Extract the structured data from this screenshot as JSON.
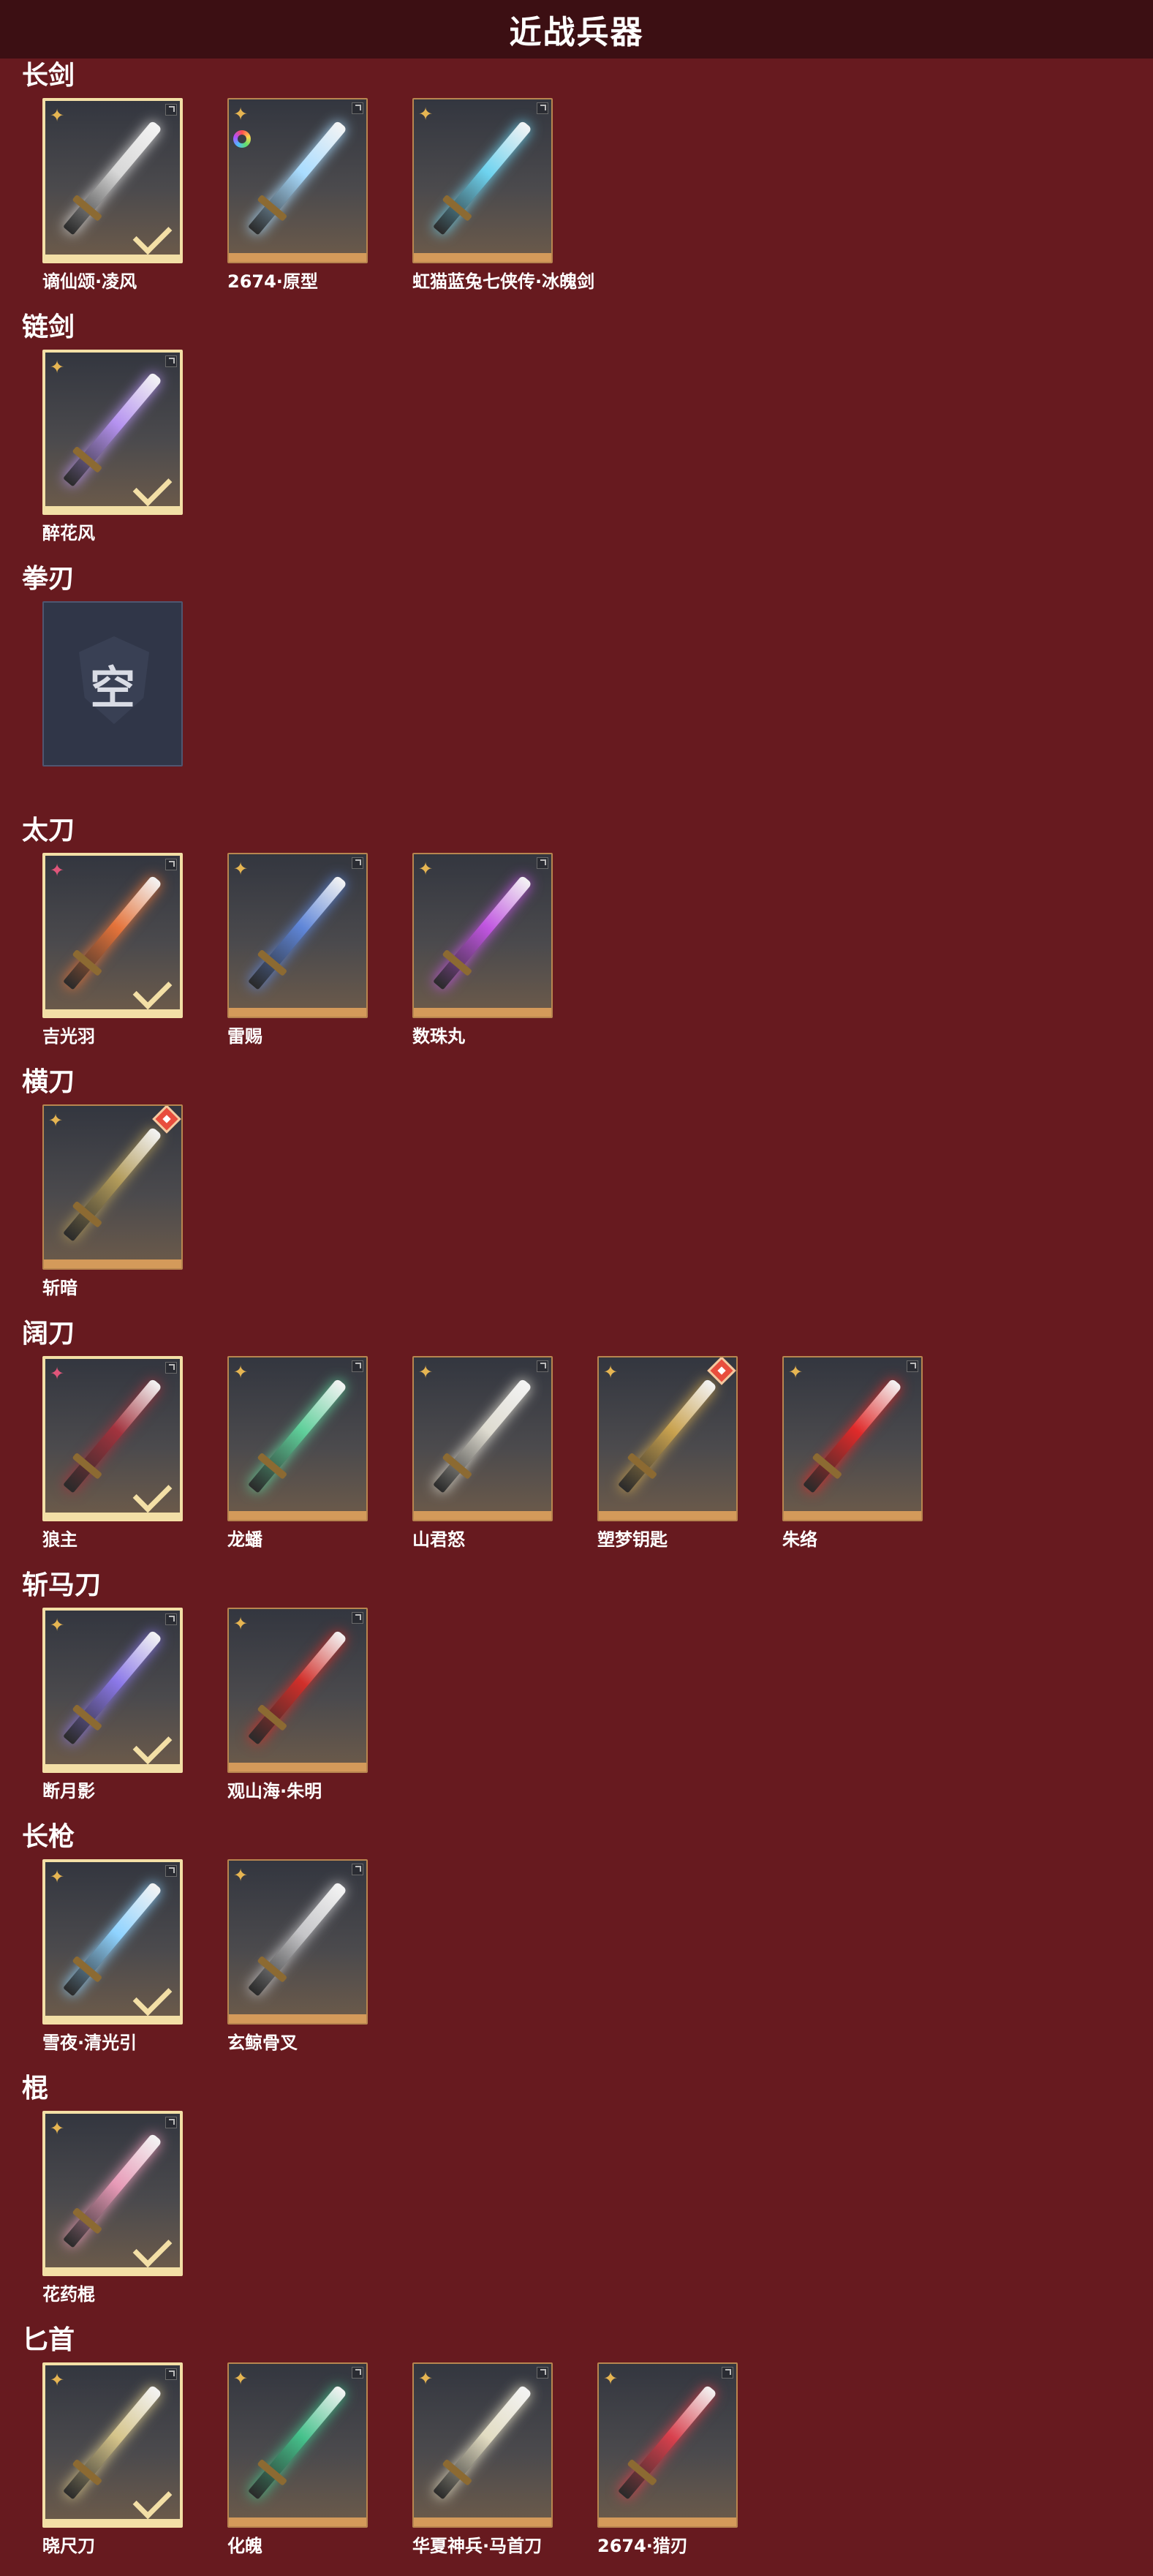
{
  "header": {
    "title": "近战兵器"
  },
  "categories": [
    {
      "label": "长剑",
      "items": [
        {
          "name": "谪仙颂·凌风",
          "equipped": true,
          "rarity": "gold",
          "lock": false,
          "ring": false,
          "accent": "#d7d7d7"
        },
        {
          "name": "2674·原型",
          "equipped": false,
          "rarity": "gold",
          "lock": false,
          "ring": true,
          "accent": "#a9dcff"
        },
        {
          "name": "虹猫蓝兔七侠传·冰魄剑",
          "equipped": false,
          "rarity": "gold",
          "lock": false,
          "ring": false,
          "accent": "#6ed3ef"
        }
      ]
    },
    {
      "label": "链剑",
      "items": [
        {
          "name": "醉花风",
          "equipped": true,
          "rarity": "gold",
          "lock": false,
          "ring": false,
          "accent": "#b592f0"
        }
      ]
    },
    {
      "label": "拳刃",
      "items": [
        {
          "name": "",
          "empty": true,
          "empty_text": "空"
        }
      ]
    },
    {
      "label": "太刀",
      "items": [
        {
          "name": "吉光羽",
          "equipped": true,
          "rarity": "pink",
          "lock": false,
          "ring": false,
          "accent": "#e4733a"
        },
        {
          "name": "雷赐",
          "equipped": false,
          "rarity": "gold",
          "lock": false,
          "ring": false,
          "accent": "#5f86d8"
        },
        {
          "name": "数珠丸",
          "equipped": false,
          "rarity": "gold",
          "lock": false,
          "ring": false,
          "accent": "#c055e0"
        }
      ]
    },
    {
      "label": "横刀",
      "items": [
        {
          "name": "斩暗",
          "equipped": false,
          "rarity": "gold",
          "lock": true,
          "ring": false,
          "accent": "#b29b5a"
        }
      ]
    },
    {
      "label": "阔刀",
      "items": [
        {
          "name": "狼主",
          "equipped": true,
          "rarity": "pink",
          "lock": false,
          "ring": false,
          "accent": "#a2333e"
        },
        {
          "name": "龙蟠",
          "equipped": false,
          "rarity": "gold",
          "lock": false,
          "ring": false,
          "accent": "#5fcf9a"
        },
        {
          "name": "山君怒",
          "equipped": false,
          "rarity": "gold",
          "lock": false,
          "ring": false,
          "accent": "#dedbd0"
        },
        {
          "name": "塑梦钥匙",
          "equipped": false,
          "rarity": "gold",
          "lock": true,
          "ring": false,
          "accent": "#c9a24f"
        },
        {
          "name": "朱络",
          "equipped": false,
          "rarity": "gold",
          "lock": false,
          "ring": false,
          "accent": "#e02a2a"
        }
      ]
    },
    {
      "label": "斩马刀",
      "items": [
        {
          "name": "断月影",
          "equipped": true,
          "rarity": "gold",
          "lock": false,
          "ring": false,
          "accent": "#8b78e8"
        },
        {
          "name": "观山海·朱明",
          "equipped": false,
          "rarity": "gold",
          "lock": false,
          "ring": false,
          "accent": "#d12f2a"
        }
      ]
    },
    {
      "label": "长枪",
      "items": [
        {
          "name": "雪夜·清光引",
          "equipped": true,
          "rarity": "gold",
          "lock": false,
          "ring": false,
          "accent": "#8fd3ff"
        },
        {
          "name": "玄鲸骨叉",
          "equipped": false,
          "rarity": "gold",
          "lock": false,
          "ring": false,
          "accent": "#c5c5c8"
        }
      ]
    },
    {
      "label": "棍",
      "items": [
        {
          "name": "花药棍",
          "equipped": true,
          "rarity": "gold",
          "lock": false,
          "ring": false,
          "accent": "#e79ab7"
        }
      ]
    },
    {
      "label": "匕首",
      "items": [
        {
          "name": "晓尺刀",
          "equipped": true,
          "rarity": "gold",
          "lock": false,
          "ring": false,
          "accent": "#d5c48a"
        },
        {
          "name": "化魄",
          "equipped": false,
          "rarity": "gold",
          "lock": false,
          "ring": false,
          "accent": "#45c18b"
        },
        {
          "name": "华夏神兵·马首刀",
          "equipped": false,
          "rarity": "gold",
          "lock": false,
          "ring": false,
          "accent": "#e2dcc2"
        },
        {
          "name": "2674·猎刃",
          "equipped": false,
          "rarity": "gold",
          "lock": false,
          "ring": false,
          "accent": "#d8404d"
        }
      ]
    }
  ]
}
